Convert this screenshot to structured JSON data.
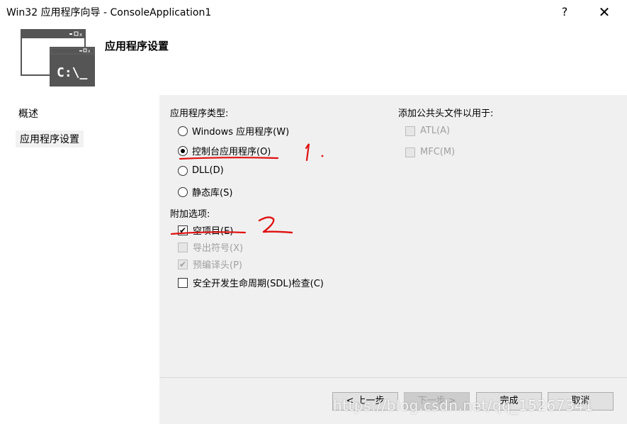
{
  "window": {
    "title": "Win32 应用程序向导 - ConsoleApplication1",
    "help": "?",
    "close": "✕"
  },
  "banner": {
    "title": "应用程序设置",
    "icon_text": "C:\\_"
  },
  "nav": {
    "items": [
      {
        "label": "概述"
      },
      {
        "label": "应用程序设置"
      }
    ]
  },
  "app_type": {
    "label": "应用程序类型:",
    "options": [
      {
        "label": "Windows 应用程序(W)",
        "checked": false
      },
      {
        "label": "控制台应用程序(O)",
        "checked": true
      },
      {
        "label": "DLL(D)",
        "checked": false
      },
      {
        "label": "静态库(S)",
        "checked": false
      }
    ]
  },
  "extra": {
    "label": "附加选项:",
    "options": [
      {
        "label": "空项目(E)",
        "checked": true,
        "enabled": true
      },
      {
        "label": "导出符号(X)",
        "checked": false,
        "enabled": false
      },
      {
        "label": "预编译头(P)",
        "checked": true,
        "enabled": false
      },
      {
        "label": "安全开发生命周期(SDL)检查(C)",
        "checked": false,
        "enabled": true
      }
    ]
  },
  "common_headers": {
    "label": "添加公共头文件以用于:",
    "options": [
      {
        "label": "ATL(A)",
        "checked": false,
        "enabled": false
      },
      {
        "label": "MFC(M)",
        "checked": false,
        "enabled": false
      }
    ]
  },
  "buttons": {
    "prev": "< 上一步",
    "next": "下一步 >",
    "finish": "完成",
    "cancel": "取消"
  },
  "annotations": {
    "mark1": "1.",
    "mark2": "2"
  },
  "watermark": "https://blog.csdn.net/qq_15267341",
  "colors": {
    "annotation": "#e01010",
    "panel_bg": "#f0f0f0",
    "icon_dark": "#555555"
  }
}
